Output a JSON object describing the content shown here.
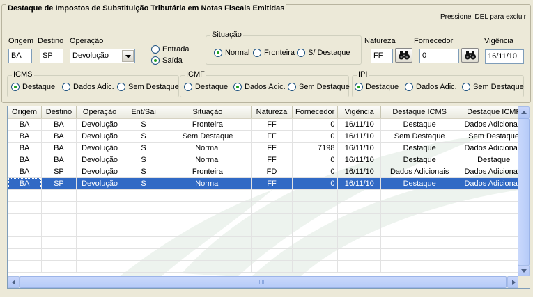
{
  "title": "Destaque de Impostos de Substituição Tributária em Notas Fiscais Emitidas",
  "del_hint": "Pressionel DEL para excluir",
  "filters": {
    "origem": {
      "label": "Origem",
      "value": "BA"
    },
    "destino": {
      "label": "Destino",
      "value": "SP"
    },
    "operacao": {
      "label": "Operação",
      "value": "Devolução"
    },
    "ent_sai": {
      "options": [
        "Entrada",
        "Saída"
      ],
      "selected": "Saída"
    },
    "situacao": {
      "label": "Situação",
      "options": [
        "Normal",
        "Fronteira",
        "S/ Destaque"
      ],
      "selected": "Normal"
    },
    "natureza": {
      "label": "Natureza",
      "value": "FF"
    },
    "fornecedor": {
      "label": "Fornecedor",
      "value": "0"
    },
    "vigencia": {
      "label": "Vigência",
      "value": "16/11/10"
    },
    "icms": {
      "label": "ICMS",
      "options": [
        "Destaque",
        "Dados Adic.",
        "Sem Destaque"
      ],
      "selected": "Destaque"
    },
    "icmf": {
      "label": "ICMF",
      "options": [
        "Destaque",
        "Dados Adic.",
        "Sem Destaque"
      ],
      "selected": "Dados Adic."
    },
    "ipi": {
      "label": "IPI",
      "options": [
        "Destaque",
        "Dados Adic.",
        "Sem Destaque"
      ],
      "selected": "Destaque"
    }
  },
  "grid": {
    "columns": [
      "Origem",
      "Destino",
      "Operação",
      "Ent/Sai",
      "Situação",
      "Natureza",
      "Fornecedor",
      "Vigência",
      "Destaque ICMS",
      "Destaque ICMF"
    ],
    "rows": [
      [
        "BA",
        "BA",
        "Devolução",
        "S",
        "Fronteira",
        "FF",
        "0",
        "16/11/10",
        "Destaque",
        "Dados Adicionais"
      ],
      [
        "BA",
        "BA",
        "Devolução",
        "S",
        "Sem Destaque",
        "FF",
        "0",
        "16/11/10",
        "Sem Destaque",
        "Sem Destaque"
      ],
      [
        "BA",
        "BA",
        "Devolução",
        "S",
        "Normal",
        "FF",
        "7198",
        "16/11/10",
        "Destaque",
        "Dados Adicionais"
      ],
      [
        "BA",
        "BA",
        "Devolução",
        "S",
        "Normal",
        "FF",
        "0",
        "16/11/10",
        "Destaque",
        "Destaque"
      ],
      [
        "BA",
        "SP",
        "Devolução",
        "S",
        "Fronteira",
        "FD",
        "0",
        "16/11/10",
        "Dados Adicionais",
        "Dados Adicionais"
      ],
      [
        "BA",
        "SP",
        "Devolução",
        "S",
        "Normal",
        "FF",
        "0",
        "16/11/10",
        "Destaque",
        "Dados Adicionais"
      ]
    ],
    "selected_row": 5
  },
  "colors": {
    "selection": "#316ac5",
    "radio_dot": "#21a121"
  },
  "icons": [
    "dropdown-arrow-icon",
    "binoculars-icon",
    "scroll-up-icon",
    "scroll-down-icon",
    "scroll-left-icon",
    "scroll-right-icon"
  ]
}
